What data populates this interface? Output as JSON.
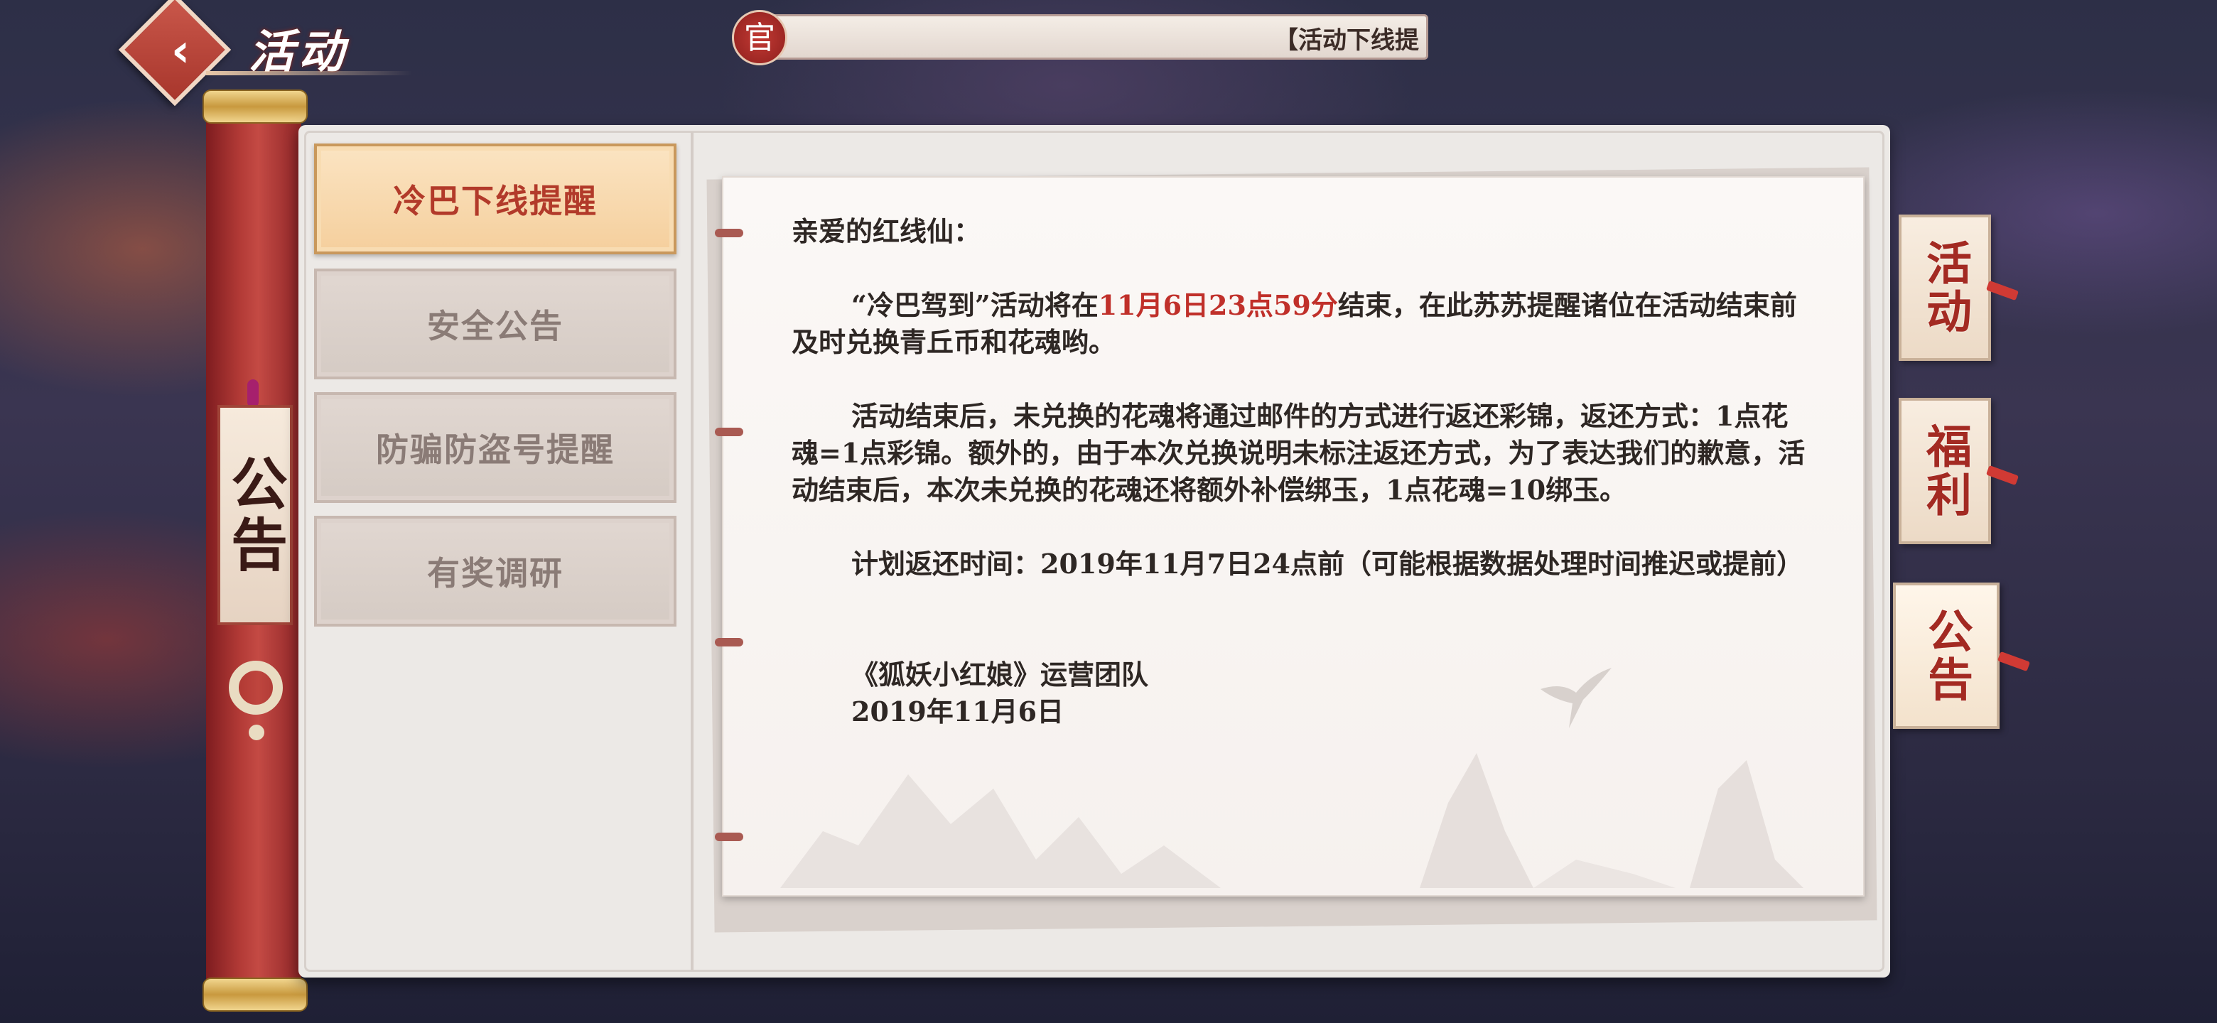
{
  "header": {
    "title": "活动",
    "ticker_badge": "官",
    "ticker_text": "【活动下线提"
  },
  "left_scroll": {
    "tag_label": "公告"
  },
  "tabs": [
    {
      "label": "冷巴下线提醒",
      "active": true
    },
    {
      "label": "安全公告",
      "active": false
    },
    {
      "label": "防骗防盗号提醒",
      "active": false
    },
    {
      "label": "有奖调研",
      "active": false
    }
  ],
  "side_tabs": [
    {
      "label": "活动",
      "active": false
    },
    {
      "label": "福利",
      "active": false
    },
    {
      "label": "公告",
      "active": true
    }
  ],
  "content": {
    "greeting": "亲爱的红线仙：",
    "p1_before": "“冷巴驾到”活动将在",
    "p1_highlight": "11月6日23点59分",
    "p1_after": "结束，在此苏苏提醒诸位在活动结束前及时兑换青丘币和花魂哟。",
    "p2": "活动结束后，未兑换的花魂将通过邮件的方式进行返还彩锦，返还方式：1点花魂=1点彩锦。额外的，由于本次兑换说明未标注返还方式，为了表达我们的歉意，活动结束后，本次未兑换的花魂还将额外补偿绑玉，1点花魂=10绑玉。",
    "p3": "计划返还时间：2019年11月7日24点前（可能根据数据处理时间推迟或提前）",
    "signature": "《狐妖小红娘》运营团队",
    "date": "2019年11月6日"
  },
  "colors": {
    "highlight": "#c0302a",
    "scroll_red": "#b23a36",
    "active_tab": "#f5cf9d"
  }
}
